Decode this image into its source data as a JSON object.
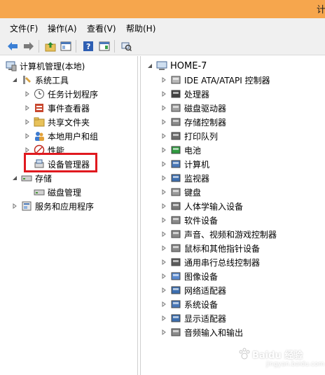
{
  "window": {
    "title_glyph": "计"
  },
  "menu": [
    "文件(F)",
    "操作(A)",
    "查看(V)",
    "帮助(H)"
  ],
  "left_tree": {
    "root": "计算机管理(本地)",
    "system_tools": "系统工具",
    "task_scheduler": "任务计划程序",
    "event_viewer": "事件查看器",
    "shared_folders": "共享文件夹",
    "local_users": "本地用户和组",
    "performance": "性能",
    "device_manager": "设备管理器",
    "storage": "存储",
    "disk_management": "磁盘管理",
    "services_apps": "服务和应用程序"
  },
  "right_tree": {
    "root": "HOME-7",
    "items": [
      "IDE ATA/ATAPI 控制器",
      "处理器",
      "磁盘驱动器",
      "存储控制器",
      "打印队列",
      "电池",
      "计算机",
      "监视器",
      "键盘",
      "人体学输入设备",
      "软件设备",
      "声音、视频和游戏控制器",
      "鼠标和其他指针设备",
      "通用串行总线控制器",
      "图像设备",
      "网络适配器",
      "系统设备",
      "显示适配器",
      "音频输入和输出"
    ]
  },
  "watermark": {
    "text": "Baidu 经验",
    "sub": "jingyan.baidu.com"
  },
  "colors": {
    "titlebar": "#f6a64d",
    "highlight": "#e0191f"
  }
}
